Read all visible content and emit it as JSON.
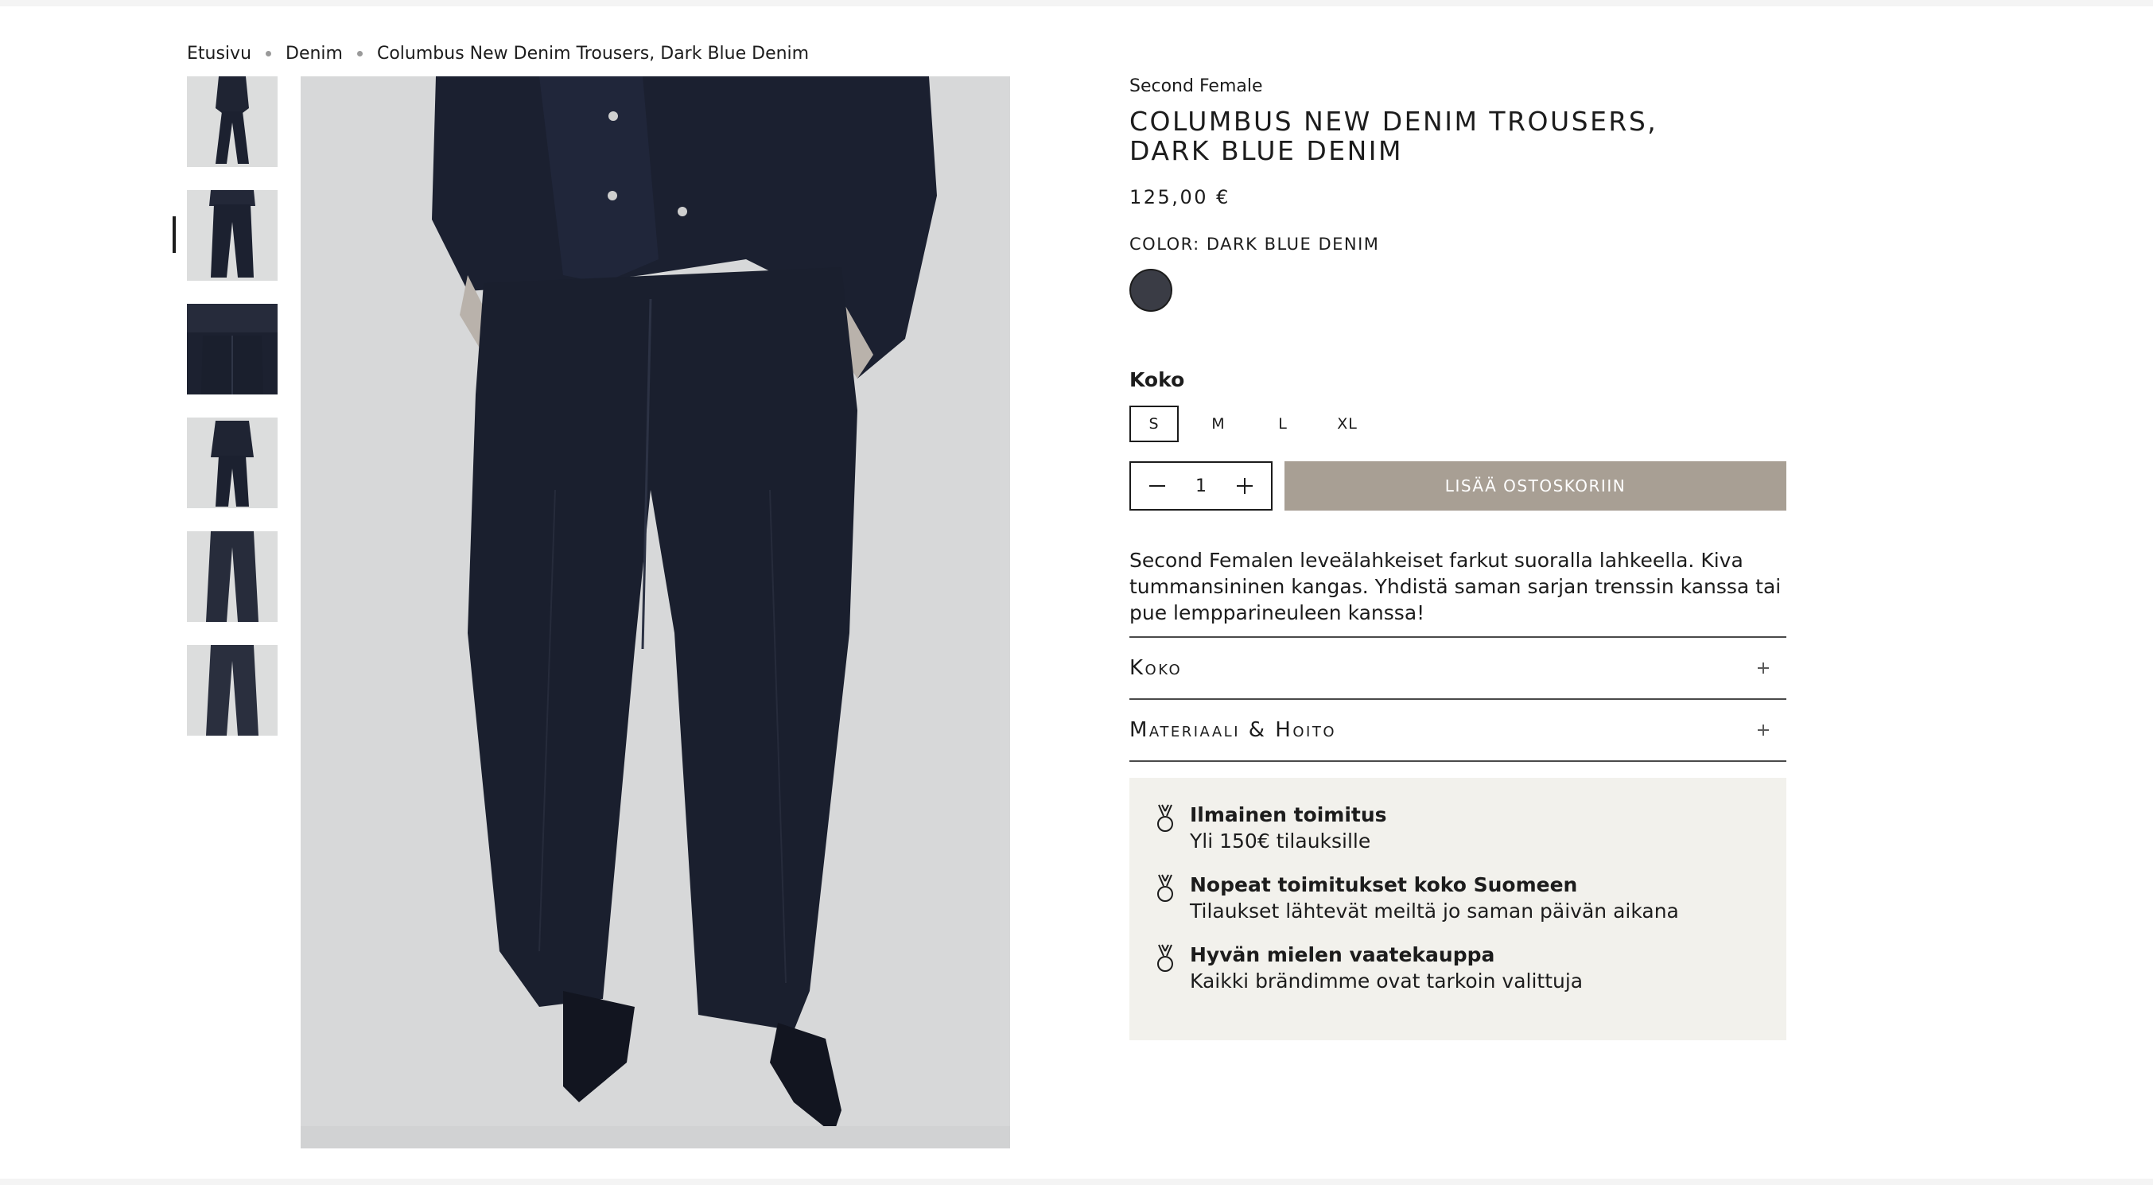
{
  "breadcrumb": {
    "home": "Etusivu",
    "category": "Denim",
    "current": "Columbus New Denim Trousers, Dark Blue Denim"
  },
  "gallery": {
    "thumbnails": [
      {
        "alt": "thumbnail 1"
      },
      {
        "alt": "thumbnail 2"
      },
      {
        "alt": "thumbnail 3"
      },
      {
        "alt": "thumbnail 4"
      },
      {
        "alt": "thumbnail 5"
      },
      {
        "alt": "thumbnail 6"
      }
    ],
    "selected_index": 1
  },
  "product": {
    "brand": "Second Female",
    "title_line1": "Columbus New Denim Trousers,",
    "title_line2": "Dark Blue Denim",
    "price": "125,00 €",
    "color_label": "Color: Dark Blue Denim",
    "swatch_color": "#3a3c45"
  },
  "size": {
    "label": "Koko",
    "options": [
      "S",
      "M",
      "L",
      "XL"
    ],
    "selected": "S"
  },
  "cart": {
    "quantity": "1",
    "add_label": "Lisää ostoskoriin",
    "button_color": "#a89f94"
  },
  "description": "Second Femalen leveälahkeiset farkut suoralla lahkeella. Kiva tummansininen kangas. Yhdistä saman sarjan trenssin kanssa tai pue lempparineuleen kanssa!",
  "accordions": [
    {
      "title": "Koko"
    },
    {
      "title": "Materiaali & Hoito"
    }
  ],
  "perks": [
    {
      "title": "Ilmainen toimitus",
      "subtitle": "Yli 150€ tilauksille",
      "icon": "medal-icon"
    },
    {
      "title": "Nopeat toimitukset koko Suomeen",
      "subtitle": "Tilaukset lähtevät meiltä jo saman päivän aikana",
      "icon": "medal-icon"
    },
    {
      "title": "Hyvän mielen vaatekauppa",
      "subtitle": "Kaikki brändimme ovat tarkoin valittuja",
      "icon": "medal-icon"
    }
  ]
}
